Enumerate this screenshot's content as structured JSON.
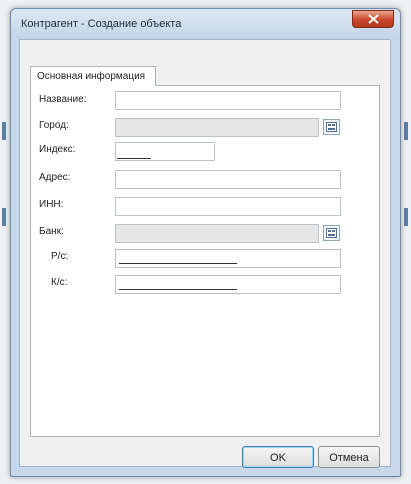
{
  "window": {
    "title": "Контрагент - Создание объекта"
  },
  "tabs": [
    {
      "label": "Основная информация"
    }
  ],
  "form": {
    "name_label": "Название:",
    "city_label": "Город:",
    "index_label": "Индекс:",
    "address_label": "Адрес:",
    "inn_label": "ИНН:",
    "bank_label": "Банк:",
    "account_label": "Р/с:",
    "corr_account_label": "К/с:"
  },
  "buttons": {
    "ok": "OK",
    "cancel": "Отмена"
  },
  "icons": {
    "city_picker": "lookup-icon",
    "bank_picker": "lookup-icon",
    "close": "close-icon"
  },
  "colors": {
    "close_button": "#c8452a",
    "titlebar": "#c3d5e9",
    "readonly_field": "#e6e6e6"
  }
}
